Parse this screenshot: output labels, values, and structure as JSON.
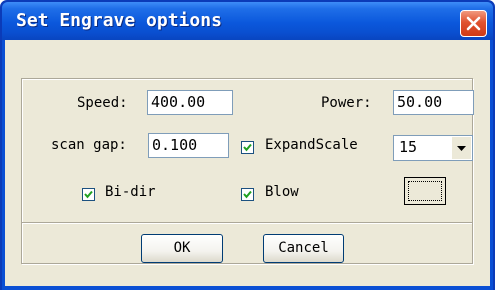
{
  "window": {
    "title": "Set Engrave options"
  },
  "fields": {
    "speed": {
      "label": "Speed:",
      "value": "400.00"
    },
    "power": {
      "label": "Power:",
      "value": "50.00"
    },
    "scan_gap": {
      "label": "scan gap:",
      "value": "0.100"
    }
  },
  "checkboxes": {
    "expand_scale": {
      "label": "ExpandScale",
      "checked": true
    },
    "bi_dir": {
      "label": "Bi-dir",
      "checked": true
    },
    "blow": {
      "label": "Blow",
      "checked": true
    }
  },
  "expand_scale_select": {
    "selected": "15"
  },
  "buttons": {
    "ok": "OK",
    "cancel": "Cancel"
  },
  "colors": {
    "titlebar": "#0a4fd4",
    "client": "#ece9d8",
    "close": "#e0522f"
  }
}
